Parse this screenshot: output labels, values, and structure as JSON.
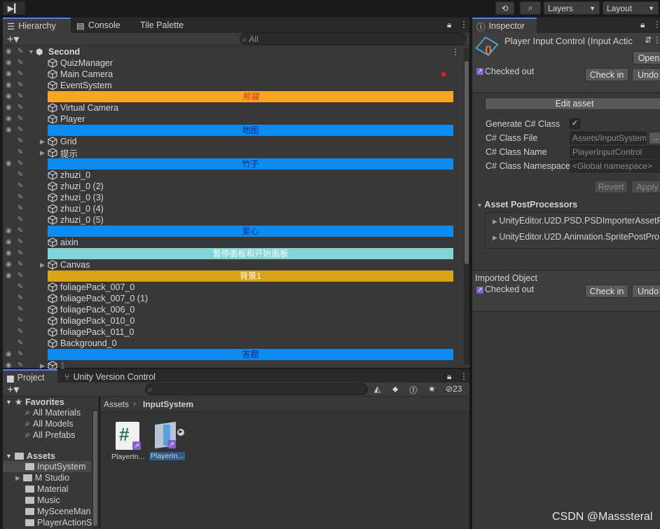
{
  "toolbar": {
    "layers": "Layers",
    "layout": "Layout"
  },
  "hierarchy": {
    "tabs": [
      "Hierarchy",
      "Console",
      "Tile Palette"
    ],
    "search_placeholder": "All",
    "scene": "Second",
    "rows": [
      {
        "type": "obj",
        "label": "QuizManager"
      },
      {
        "type": "obj",
        "label": "Main Camera"
      },
      {
        "type": "obj",
        "label": "EventSystem"
      },
      {
        "type": "bar",
        "label": "熊猫",
        "bg": "#f5a623",
        "fg": "#e0301e",
        "italic": true
      },
      {
        "type": "obj",
        "label": "Virtual Camera"
      },
      {
        "type": "obj",
        "label": "Player"
      },
      {
        "type": "bar",
        "label": "地图",
        "bg": "#0a8cf0",
        "fg": "#0b2a80"
      },
      {
        "type": "obj",
        "label": "Grid",
        "fold": true
      },
      {
        "type": "obj",
        "label": "提示",
        "fold": true
      },
      {
        "type": "bar",
        "label": "竹子",
        "bg": "#0a8cf0",
        "fg": "#0b2a80"
      },
      {
        "type": "obj",
        "label": "zhuzi_0"
      },
      {
        "type": "obj",
        "label": "zhuzi_0 (2)"
      },
      {
        "type": "obj",
        "label": "zhuzi_0 (3)"
      },
      {
        "type": "obj",
        "label": "zhuzi_0 (4)"
      },
      {
        "type": "obj",
        "label": "zhuzi_0 (5)"
      },
      {
        "type": "bar",
        "label": "爱心",
        "bg": "#0a8cf0",
        "fg": "#0b2a80"
      },
      {
        "type": "obj",
        "label": "aixin"
      },
      {
        "type": "bar",
        "label": "暂停面板和开始面板",
        "bg": "#7fd6d6",
        "fg": "#ffffff"
      },
      {
        "type": "obj",
        "label": "Canvas",
        "fold": true
      },
      {
        "type": "bar",
        "label": "背景1",
        "bg": "#d9a416",
        "fg": "#ffffff"
      },
      {
        "type": "obj",
        "label": "foliagePack_007_0"
      },
      {
        "type": "obj",
        "label": "foliagePack_007_0 (1)"
      },
      {
        "type": "obj",
        "label": "foliagePack_006_0"
      },
      {
        "type": "obj",
        "label": "foliagePack_010_0"
      },
      {
        "type": "obj",
        "label": "foliagePack_011_0"
      },
      {
        "type": "obj",
        "label": "Background_0"
      },
      {
        "type": "bar",
        "label": "答题",
        "bg": "#0a8cf0",
        "fg": "#0b2a80"
      },
      {
        "type": "obj",
        "label": "1",
        "fold": true
      }
    ]
  },
  "inspector": {
    "tab": "Inspector",
    "title": "Player Input Control (Input Actic",
    "open": "Open",
    "checked_out": "Checked out",
    "check_in": "Check in",
    "undo": "Undo",
    "edit_asset": "Edit asset",
    "generate_label": "Generate C# Class",
    "class_file_label": "C# Class File",
    "class_file_value": "Assets/InputSystem",
    "ellipsis": "...",
    "class_name_label": "C# Class Name",
    "class_name_value": "PlayerInputControl",
    "namespace_label": "C# Class Namespace",
    "namespace_value": "<Global namespace>",
    "revert": "Revert",
    "apply": "Apply",
    "postprocessors_title": "Asset PostProcessors",
    "postprocessors": [
      "UnityEditor.U2D.PSD.PSDImporterAssetP",
      "UnityEditor.U2D.Animation.SpritePostPro"
    ],
    "imported_object": "Imported Object",
    "checked_out2": "Checked out",
    "check_in2": "Check in",
    "undo2": "Undo"
  },
  "project": {
    "tabs": [
      "Project",
      "Unity Version Control"
    ],
    "hidden_count": "23",
    "breadcrumb_root": "Assets",
    "breadcrumb_current": "InputSystem",
    "favorites_label": "Favorites",
    "favorites": [
      "All Materials",
      "All Models",
      "All Prefabs"
    ],
    "assets_label": "Assets",
    "folders": [
      "InputSystem",
      "M Studio",
      "Material",
      "Music",
      "MySceneMan",
      "PlayerActionS"
    ],
    "files": [
      "PlayerIn...",
      "PlayerIn..."
    ]
  },
  "watermark": "CSDN @Masssteral"
}
